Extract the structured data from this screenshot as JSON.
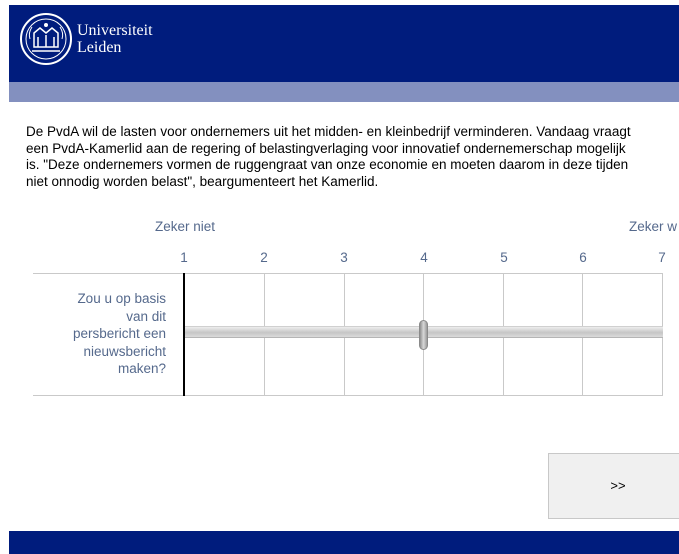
{
  "header": {
    "logo_line1": "Universiteit",
    "logo_line2": "Leiden",
    "color": "#001c7d",
    "subbar_color": "#8390bf"
  },
  "question": {
    "lines": [
      "De PvdA wil de lasten voor ondernemers uit het midden- en kleinbedrijf verminderen. Vandaag vraagt",
      "een PvdA-Kamerlid aan de regering of belastingverlaging voor innovatief ondernemerschap mogelijk",
      "is. \"Deze ondernemers vormen de ruggengraat van onze economie en moeten daarom in deze tijden",
      "niet onnodig worden belast\", beargumenteert het Kamerlid."
    ]
  },
  "scale": {
    "anchor_left": "Zeker niet",
    "anchor_right": "Zeker w",
    "ticks": [
      "1",
      "2",
      "3",
      "4",
      "5",
      "6",
      "7"
    ]
  },
  "slider": {
    "label_lines": [
      "Zou u op basis",
      "van dit",
      "persbericht een",
      "nieuwsbericht",
      "maken?"
    ],
    "value": 4,
    "min": 1,
    "max": 7
  },
  "navigation": {
    "next_label": ">>"
  },
  "colors": {
    "label_text": "#55698c",
    "footer": "#001c7d"
  }
}
